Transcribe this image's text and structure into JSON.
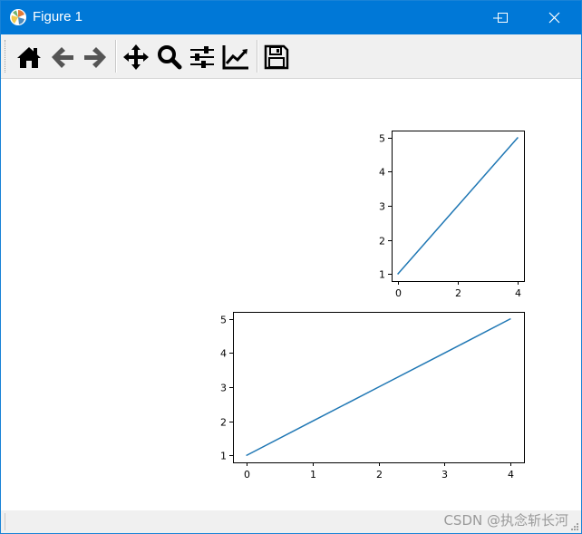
{
  "window": {
    "title": "Figure 1",
    "controls": [
      "minimize",
      "maximize",
      "close"
    ]
  },
  "toolbar": {
    "buttons": [
      {
        "name": "home",
        "icon": "home-icon"
      },
      {
        "name": "back",
        "icon": "arrow-left-icon"
      },
      {
        "name": "forward",
        "icon": "arrow-right-icon"
      },
      {
        "name": "pan",
        "icon": "move-icon"
      },
      {
        "name": "zoom",
        "icon": "magnifier-icon"
      },
      {
        "name": "configure-subplots",
        "icon": "sliders-icon"
      },
      {
        "name": "edit-axes",
        "icon": "line-chart-icon"
      },
      {
        "name": "save",
        "icon": "floppy-disk-icon"
      }
    ]
  },
  "statusbar": {
    "watermark": "CSDN @执念斩长河"
  },
  "colors": {
    "titlebar": "#0078d7",
    "line": "#1f77b4",
    "toolbar_bg": "#f0f0f0"
  },
  "chart_data": [
    {
      "type": "line",
      "title": "",
      "xlabel": "",
      "ylabel": "",
      "x": [
        0,
        1,
        2,
        3,
        4
      ],
      "series": [
        {
          "values": [
            1,
            2,
            3,
            4,
            5
          ]
        }
      ],
      "xlim": [
        -0.2,
        4.2
      ],
      "ylim": [
        0.8,
        5.2
      ],
      "xticks": [
        0,
        2,
        4
      ],
      "yticks": [
        1,
        2,
        3,
        4,
        5
      ],
      "grid": false
    },
    {
      "type": "line",
      "title": "",
      "xlabel": "",
      "ylabel": "",
      "x": [
        0,
        1,
        2,
        3,
        4
      ],
      "series": [
        {
          "values": [
            1,
            2,
            3,
            4,
            5
          ]
        }
      ],
      "xlim": [
        -0.2,
        4.2
      ],
      "ylim": [
        0.8,
        5.2
      ],
      "xticks": [
        0,
        1,
        2,
        3,
        4
      ],
      "yticks": [
        1,
        2,
        3,
        4,
        5
      ],
      "grid": false
    }
  ]
}
